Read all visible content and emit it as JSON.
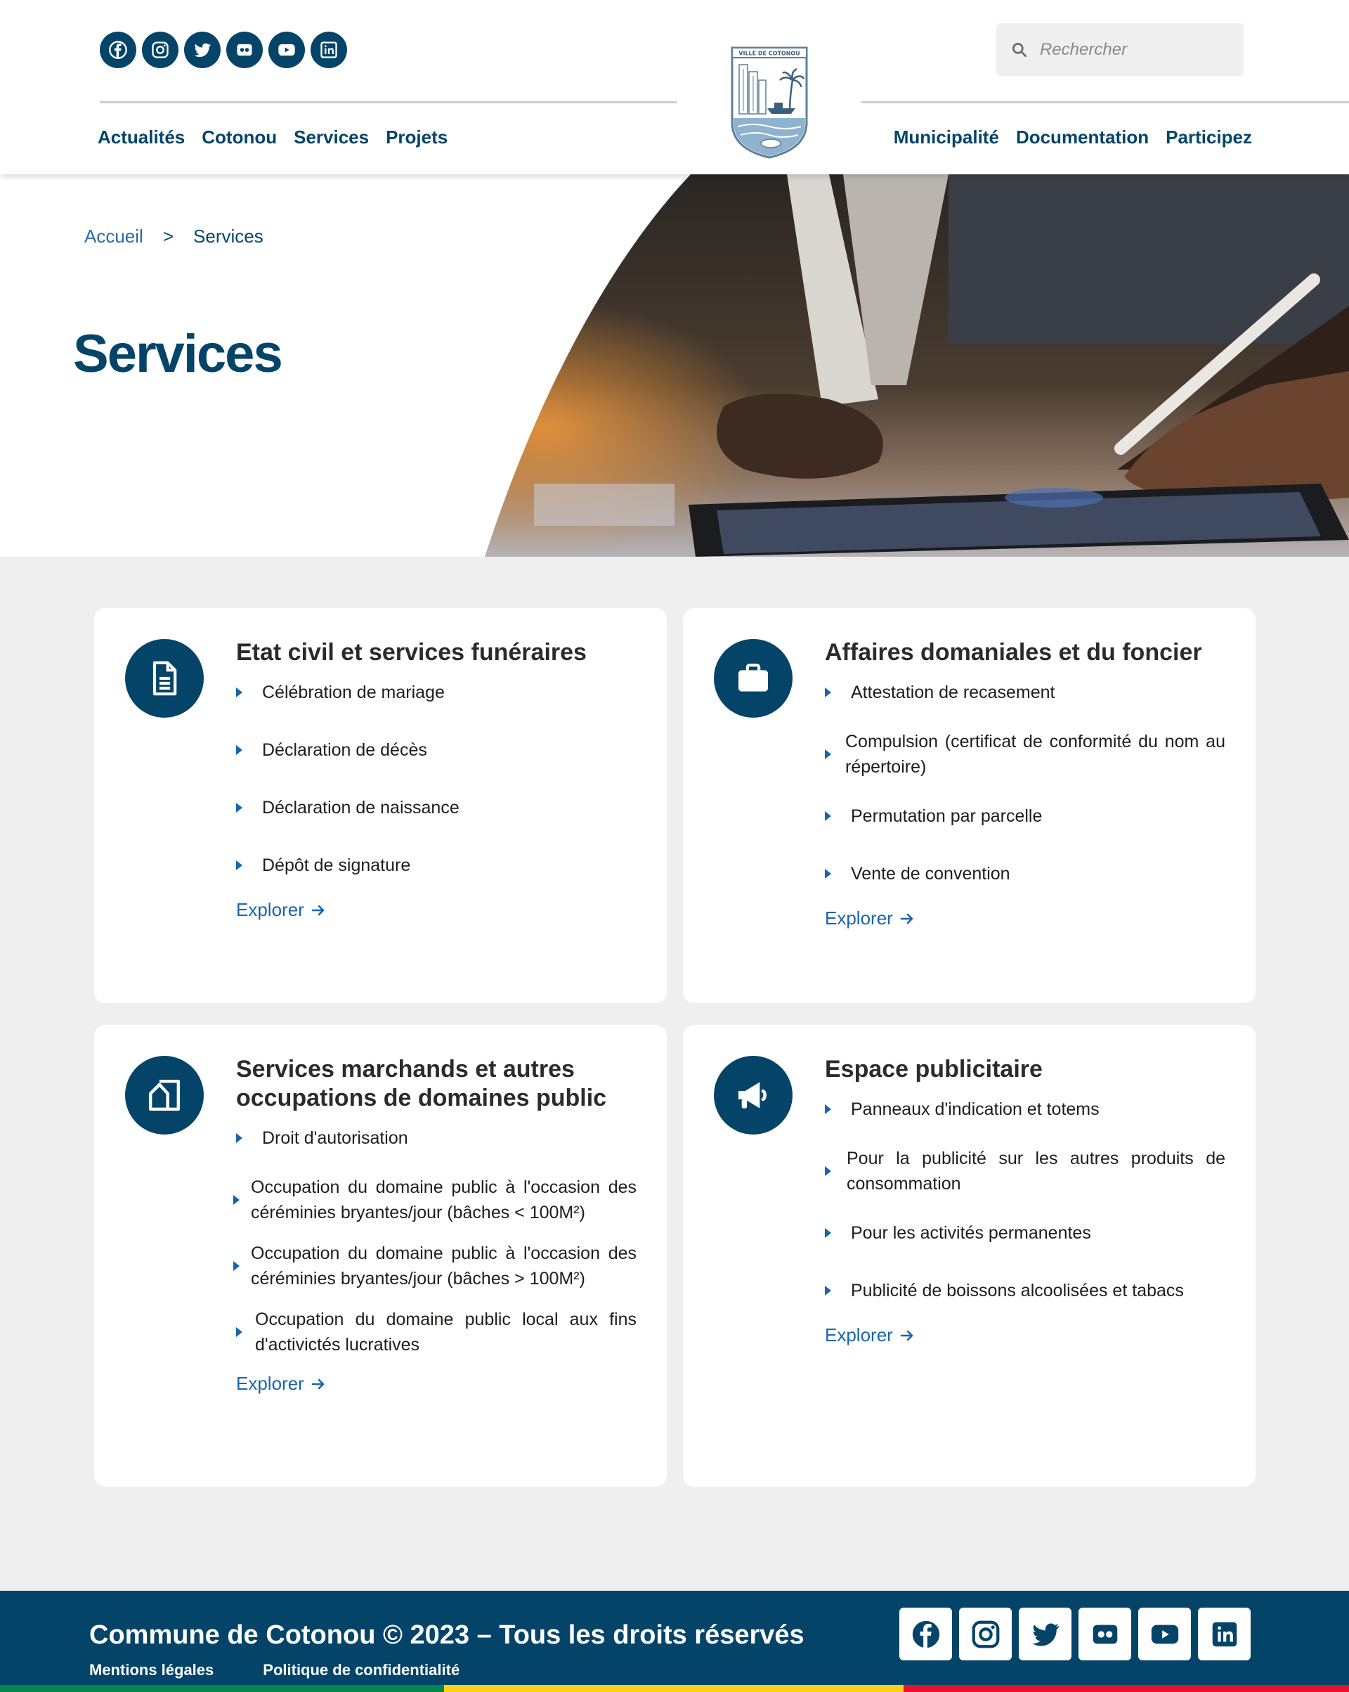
{
  "header": {
    "social": [
      "facebook-icon",
      "instagram-icon",
      "twitter-icon",
      "flickr-icon",
      "youtube-icon",
      "linkedin-icon"
    ],
    "nav_left": [
      "Actualités",
      "Cotonou",
      "Services",
      "Projets"
    ],
    "nav_right": [
      "Municipalité",
      "Documentation",
      "Participez"
    ],
    "logo_text": "VILLE DE COTONOU",
    "search_placeholder": "Rechercher"
  },
  "breadcrumb": {
    "home": "Accueil",
    "separator": ">",
    "current": "Services"
  },
  "page_title": "Services",
  "cards": [
    {
      "icon": "document-icon",
      "title": "Etat civil et services funéraires",
      "items": [
        "Célébration de mariage",
        "Déclaration de décès",
        "Déclaration de naissance",
        "Dépôt de signature"
      ],
      "link": "Explorer"
    },
    {
      "icon": "briefcase-icon",
      "title": "Affaires domaniales et du foncier",
      "items": [
        "Attestation de recasement",
        "Compulsion (certificat de conformité du nom au répertoire)",
        "Permutation par parcelle",
        "Vente de convention"
      ],
      "link": "Explorer"
    },
    {
      "icon": "home-icon",
      "title": "Services marchands et autres occupations de domaines public",
      "items": [
        "Droit d'autorisation",
        "Occupation du domaine public à l'occasion des céréminies bryantes/jour (bâches < 100M²)",
        "Occupation du domaine public à l'occasion des céréminies bryantes/jour (bâches > 100M²)",
        "Occupation du domaine public local aux fins d'activictés lucratives"
      ],
      "link": "Explorer"
    },
    {
      "icon": "megaphone-icon",
      "title": "Espace publicitaire",
      "items": [
        "Panneaux d'indication et totems",
        "Pour la publicité sur les autres produits de consommation",
        "Pour les activités permanentes",
        "Publicité de boissons alcoolisées et tabacs"
      ],
      "link": "Explorer"
    }
  ],
  "footer": {
    "title": "Commune de Cotonou © 2023 – Tous les droits réservés",
    "links": [
      "Mentions légales",
      "Politique de confidentialité"
    ],
    "social": [
      "facebook-icon",
      "instagram-icon",
      "twitter-icon",
      "flickr-icon",
      "youtube-icon",
      "linkedin-icon"
    ]
  },
  "colors": {
    "primary": "#044469",
    "link": "#1865ad",
    "background": "#efefef",
    "flag": [
      "#008751",
      "#fcd116",
      "#e8112d"
    ]
  }
}
